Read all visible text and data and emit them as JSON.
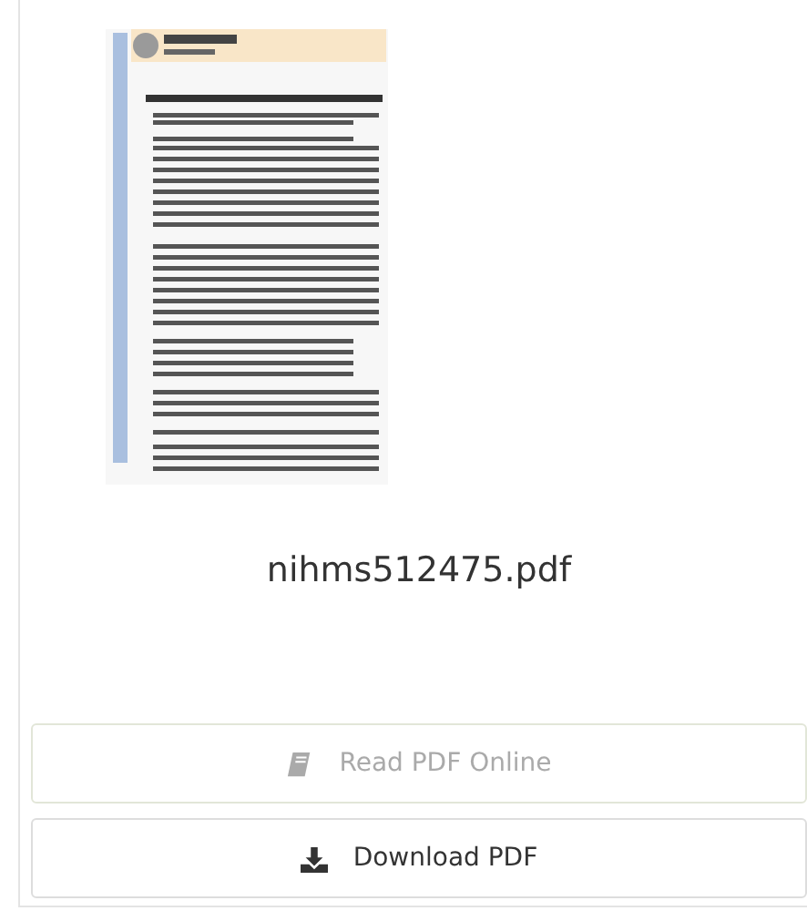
{
  "file_name": "nihms512475.pdf",
  "buttons": [
    {
      "kind": "read",
      "label": "Read PDF Online",
      "disabled": true
    },
    {
      "kind": "download",
      "label": "Download PDF",
      "disabled": false
    }
  ]
}
